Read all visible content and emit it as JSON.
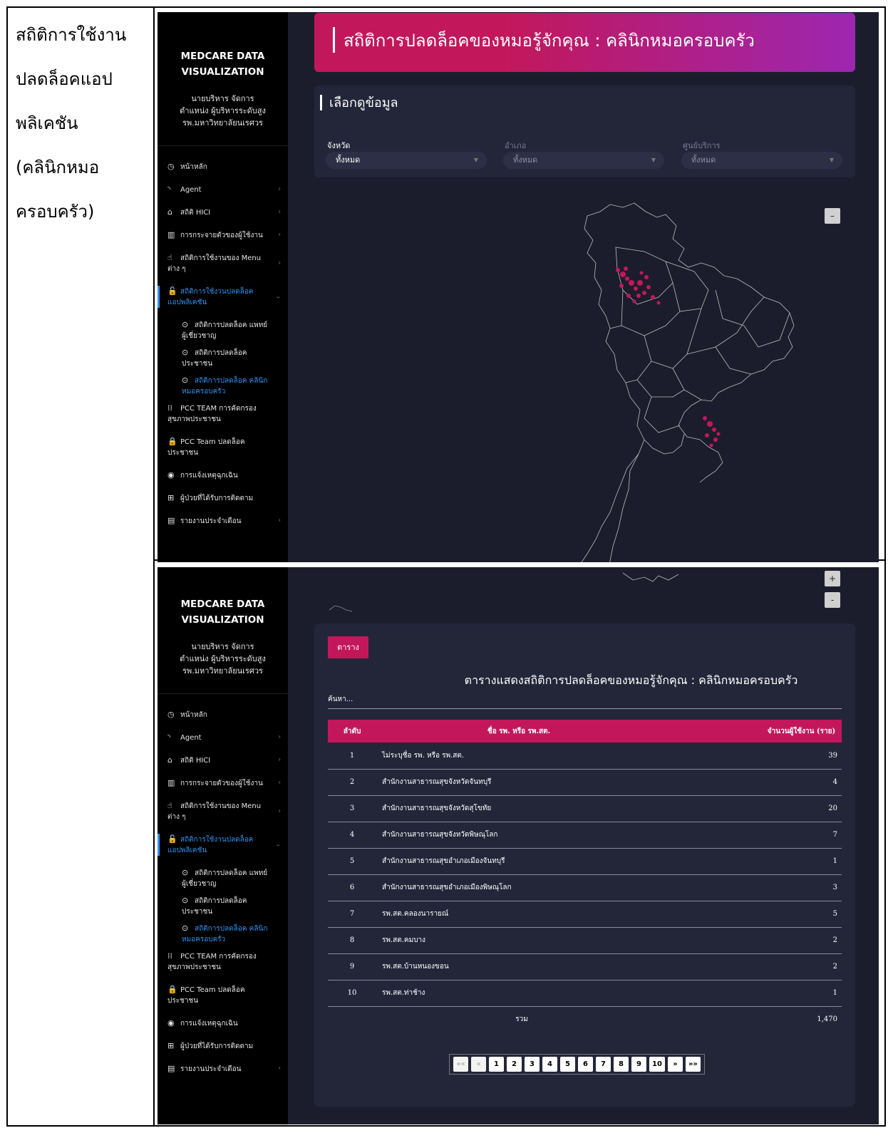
{
  "caption_lines": [
    "สถิติการใช้งาน",
    "ปลดล็อคแอป",
    "พลิเคชัน",
    "(คลินิกหมอ",
    "ครอบครัว)"
  ],
  "sidebar": {
    "brand_line1": "MEDCARE DATA",
    "brand_line2": "VISUALIZATION",
    "user_line1": "นายบริหาร จัดการ",
    "user_line2": "ตำแหน่ง ผู้บริหารระดับสูง",
    "user_line3": "รพ.มหาวิทยาลัยนเรศวร",
    "items": [
      {
        "label": "หน้าหลัก",
        "icon": "dashboard-icon",
        "glyph": "◷",
        "chevron": false
      },
      {
        "label": "Agent",
        "icon": "rss-icon",
        "glyph": "◝",
        "chevron": true
      },
      {
        "label": "สถิติ HICI",
        "icon": "home-icon",
        "glyph": "⌂",
        "chevron": true
      },
      {
        "label": "การกระจายตัวของผู้ใช้งาน",
        "icon": "map-icon",
        "glyph": "▥",
        "chevron": true
      },
      {
        "label": "สถิติการใช้งานของ Menu ต่าง ๆ",
        "icon": "hand-pointer-icon",
        "glyph": "☝",
        "chevron": true
      },
      {
        "label": "สถิติการใช้งานปลดล็อค แอปพลิเคชัน",
        "icon": "unlock-icon",
        "glyph": "🔓",
        "chevron": true,
        "active": true
      },
      {
        "label": "สถิติการปลดล็อค แพทย์ผู้เชี่ยวชาญ",
        "icon": "circle-dot-icon",
        "glyph": "⊙",
        "sub": true
      },
      {
        "label": "สถิติการปลดล็อค ประชาชน",
        "icon": "circle-dot-icon",
        "glyph": "⊙",
        "sub": true
      },
      {
        "label": "สถิติการปลดล็อค คลินิกหมอครอบครัว",
        "icon": "circle-dot-icon",
        "glyph": "⊙",
        "sub": true,
        "current": true
      },
      {
        "label": "PCC TEAM การคัดกรองสุขภาพประชาชน",
        "icon": "users-icon",
        "glyph": "⁞⁞",
        "chevron": false
      },
      {
        "label": "PCC Team ปลดล็อค ประชาชน",
        "icon": "lock-icon",
        "glyph": "🔒",
        "chevron": false
      },
      {
        "label": "การแจ้งเหตุฉุกเฉิน",
        "icon": "podcast-icon",
        "glyph": "◉",
        "chevron": false
      },
      {
        "label": "ผู้ป่วยที่ได้รับการติดตาม",
        "icon": "medkit-icon",
        "glyph": "⊞",
        "chevron": false
      },
      {
        "label": "รายงานประจำเดือน",
        "icon": "file-icon",
        "glyph": "▤",
        "chevron": true
      }
    ]
  },
  "header": {
    "title": "สถิติการปลดล็อคของหมอรู้จักคุณ : คลินิกหมอครอบครัว"
  },
  "filters": {
    "title": "เลือกดูข้อมูล",
    "province_label": "จังหวัด",
    "province_value": "ทั้งหมด",
    "district_label": "อำเภอ",
    "district_value": "ทั้งหมด",
    "center_label": "ศูนย์บริการ",
    "center_value": "ทั้งหมด"
  },
  "map": {
    "collapse_label": "–",
    "zoom_in": "+",
    "zoom_out": "-",
    "point_color": "#c2185b"
  },
  "table_section": {
    "tab_label": "ตาราง",
    "title": "ตารางแสดงสถิติการปลดล็อคของหมอรู้จักคุณ : คลินิกหมอครอบครัว",
    "search_placeholder": "ค้นหา...",
    "columns": [
      "ลำดับ",
      "ชื่อ รพ. หรือ รพ.สต.",
      "จำนวนผู้ใช้งาน (ราย)"
    ],
    "rows": [
      [
        "1",
        "ไม่ระบุชื่อ รพ. หรือ รพ.สต.",
        "39"
      ],
      [
        "2",
        "สำนักงานสาธารณสุขจังหวัดจันทบุรี",
        "4"
      ],
      [
        "3",
        "สำนักงานสาธารณสุขจังหวัดสุโขทัย",
        "20"
      ],
      [
        "4",
        "สำนักงานสาธารณสุขจังหวัดพิษณุโลก",
        "7"
      ],
      [
        "5",
        "สำนักงานสาธารณสุขอำเภอเมืองจันทบุรี",
        "1"
      ],
      [
        "6",
        "สำนักงานสาธารณสุขอำเภอเมืองพิษณุโลก",
        "3"
      ],
      [
        "7",
        "รพ.สต.คลองนารายณ์",
        "5"
      ],
      [
        "8",
        "รพ.สต.คมบาง",
        "2"
      ],
      [
        "9",
        "รพ.สต.บ้านหนองขอน",
        "2"
      ],
      [
        "10",
        "รพ.สต.ท่าช้าง",
        "1"
      ]
    ],
    "total_label": "รวม",
    "total_value": "1,470",
    "pagination": [
      "««",
      "«",
      "1",
      "2",
      "3",
      "4",
      "5",
      "6",
      "7",
      "8",
      "9",
      "10",
      "»",
      "»»"
    ]
  },
  "colors": {
    "accent": "#c2185b",
    "active_link": "#2f93f2",
    "panel": "#232639"
  }
}
